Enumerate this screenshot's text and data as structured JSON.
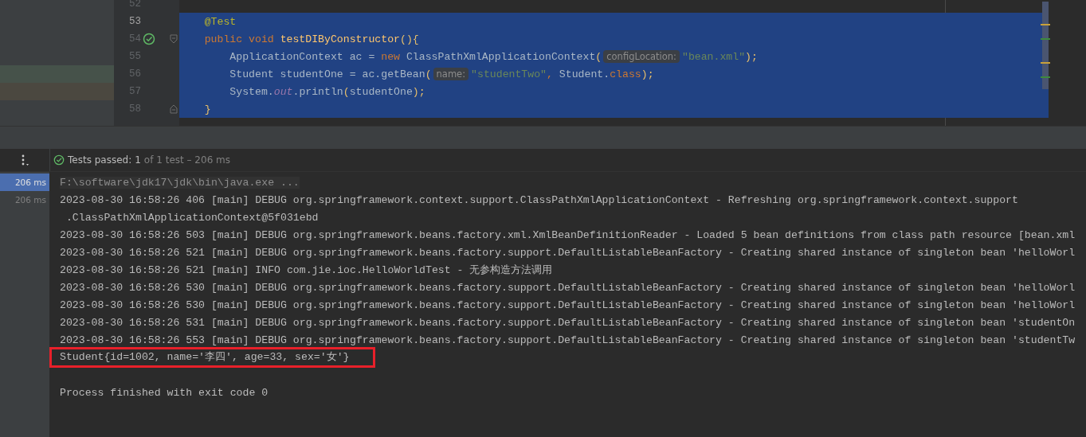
{
  "editor": {
    "lines": [
      {
        "number": "52",
        "current": false,
        "selected": false
      },
      {
        "number": "53",
        "current": true,
        "selected": true,
        "tokens": [
          {
            "kind": "annotation",
            "text": "    @Test"
          }
        ]
      },
      {
        "number": "54",
        "current": false,
        "selected": true,
        "test_passed": true,
        "fold_start": true,
        "tokens": [
          {
            "kind": "keyword",
            "text": "    public void "
          },
          {
            "kind": "method",
            "text": "testDIByConstructor"
          },
          {
            "kind": "brace",
            "text": "(){"
          }
        ]
      },
      {
        "number": "55",
        "current": false,
        "selected": true,
        "tokens": [
          {
            "kind": "plain",
            "text": "        ApplicationContext ac = "
          },
          {
            "kind": "keyword",
            "text": "new "
          },
          {
            "kind": "plain",
            "text": "ClassPathXmlApplicationContext"
          },
          {
            "kind": "brace",
            "text": "("
          },
          {
            "kind": "hint",
            "text": "configLocation:"
          },
          {
            "kind": "string",
            "text": "\"bean.xml\""
          },
          {
            "kind": "brace",
            "text": ");"
          }
        ]
      },
      {
        "number": "56",
        "current": false,
        "selected": true,
        "color": "#46524a",
        "tokens": [
          {
            "kind": "plain",
            "text": "        Student studentOne = ac.getBean"
          },
          {
            "kind": "brace",
            "text": "("
          },
          {
            "kind": "hint",
            "text": "name:"
          },
          {
            "kind": "string",
            "text": "\"studentTwo\""
          },
          {
            "kind": "keyword",
            "text": ", "
          },
          {
            "kind": "plain",
            "text": "Student."
          },
          {
            "kind": "keyword",
            "text": "class"
          },
          {
            "kind": "brace",
            "text": ");"
          }
        ]
      },
      {
        "number": "57",
        "current": false,
        "selected": true,
        "color": "#4b4840",
        "tokens": [
          {
            "kind": "plain",
            "text": "        System."
          },
          {
            "kind": "static",
            "text": "out"
          },
          {
            "kind": "plain",
            "text": ".println"
          },
          {
            "kind": "brace",
            "text": "("
          },
          {
            "kind": "plain",
            "text": "studentOne"
          },
          {
            "kind": "brace",
            "text": ");"
          }
        ]
      },
      {
        "number": "58",
        "current": false,
        "selected": true,
        "fold_end": true,
        "tokens": [
          {
            "kind": "brace",
            "text": "    }"
          }
        ]
      }
    ]
  },
  "test_bar": {
    "status": "Tests passed:",
    "count": "1",
    "detail": "of 1 test – 206 ms"
  },
  "test_tree": [
    {
      "duration": "206 ms",
      "selected": true
    },
    {
      "duration": "206 ms",
      "selected": false
    }
  ],
  "console": [
    {
      "kind": "command",
      "text": "F:\\software\\jdk17\\jdk\\bin\\java.exe ..."
    },
    {
      "kind": "log",
      "text": "2023-08-30 16:58:26 406 [main] DEBUG org.springframework.context.support.ClassPathXmlApplicationContext - Refreshing org.springframework.context.support"
    },
    {
      "kind": "log",
      "text": " .ClassPathXmlApplicationContext@5f031ebd"
    },
    {
      "kind": "log",
      "text": "2023-08-30 16:58:26 503 [main] DEBUG org.springframework.beans.factory.xml.XmlBeanDefinitionReader - Loaded 5 bean definitions from class path resource [bean.xml"
    },
    {
      "kind": "log",
      "text": "2023-08-30 16:58:26 521 [main] DEBUG org.springframework.beans.factory.support.DefaultListableBeanFactory - Creating shared instance of singleton bean 'helloWorl"
    },
    {
      "kind": "log",
      "text": "2023-08-30 16:58:26 521 [main] INFO com.jie.ioc.HelloWorldTest - 无参构造方法调用"
    },
    {
      "kind": "log",
      "text": "2023-08-30 16:58:26 530 [main] DEBUG org.springframework.beans.factory.support.DefaultListableBeanFactory - Creating shared instance of singleton bean 'helloWorl"
    },
    {
      "kind": "log",
      "text": "2023-08-30 16:58:26 530 [main] DEBUG org.springframework.beans.factory.support.DefaultListableBeanFactory - Creating shared instance of singleton bean 'helloWorl"
    },
    {
      "kind": "log",
      "text": "2023-08-30 16:58:26 531 [main] DEBUG org.springframework.beans.factory.support.DefaultListableBeanFactory - Creating shared instance of singleton bean 'studentOn"
    },
    {
      "kind": "log",
      "text": "2023-08-30 16:58:26 553 [main] DEBUG org.springframework.beans.factory.support.DefaultListableBeanFactory - Creating shared instance of singleton bean 'studentTw"
    },
    {
      "kind": "highlighted",
      "text": "Student{id=1002, name='李四', age=33, sex='女'}"
    },
    {
      "kind": "blank"
    },
    {
      "kind": "log",
      "text": "Process finished with exit code 0"
    }
  ]
}
